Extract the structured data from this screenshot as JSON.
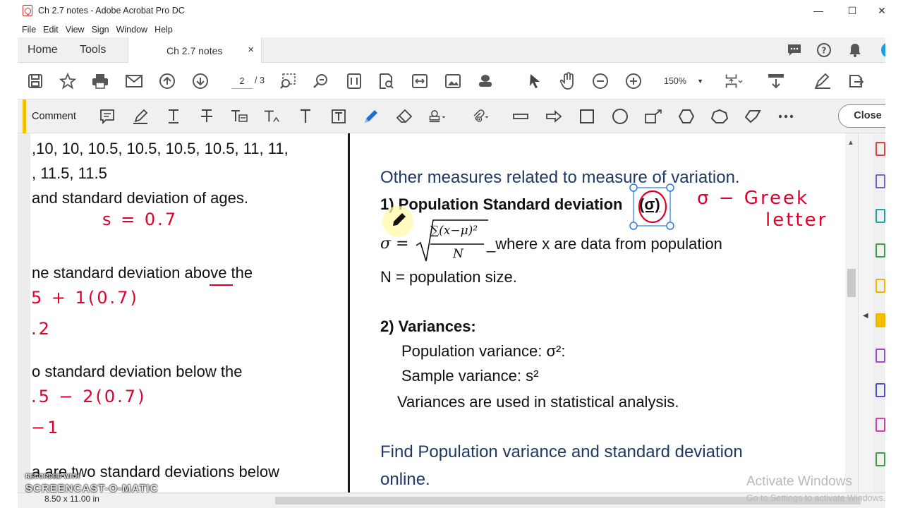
{
  "window": {
    "title": "Ch 2.7 notes - Adobe Acrobat Pro DC"
  },
  "menu": [
    "File",
    "Edit",
    "View",
    "Sign",
    "Window",
    "Help"
  ],
  "tabs": {
    "home": "Home",
    "tools": "Tools",
    "document": "Ch 2.7 notes",
    "close_glyph": "×"
  },
  "toolbar": {
    "page_current": "2",
    "page_total": "/ 3",
    "zoom": "150%"
  },
  "comment_toolbar": {
    "label": "Comment",
    "close_label": "Close",
    "accent_color": "#f2c200"
  },
  "left_page": {
    "lines": [
      ",10, 10, 10.5, 10.5, 10.5, 10.5, 11, 11,",
      ", 11.5, 11.5",
      " and standard deviation of ages.",
      "ne standard deviation above the",
      "o standard deviation below the",
      "a are two standard deviations below"
    ],
    "handwriting": [
      "s = 0.7",
      "5 + 1(0.7)",
      ".2",
      ".5 − 2(0.7)",
      "−1"
    ]
  },
  "right_page": {
    "heading": "Other measures related to measure of variation.",
    "section1_title": "1) Population Standard deviation",
    "sigma_symbol": "(σ)",
    "formula_lhs": "σ =",
    "formula_num": "∑(x−μ)²",
    "formula_den": "N",
    "formula_desc": "_where x are data from population",
    "n_def": "N = population size.",
    "section2_title": "2) Variances:",
    "pop_variance": "Population variance: σ²:",
    "sample_variance": "Sample variance: s²",
    "variances_use": "Variances are used in statistical analysis.",
    "find_line1": "Find Population variance and standard deviation",
    "find_line2": "online."
  },
  "annotation": {
    "handwriting": [
      "σ − Greek",
      "letter"
    ],
    "ink_color": "#e0002a"
  },
  "status": {
    "page_size": "8.50 x 11.00 in"
  },
  "watermarks": {
    "activate_title": "Activate Windows",
    "activate_sub": "Go to Settings to activate Windows.",
    "recorded_with": "RECORDED WITH",
    "recorder_brand": "SCREENCAST-O-MATIC"
  }
}
